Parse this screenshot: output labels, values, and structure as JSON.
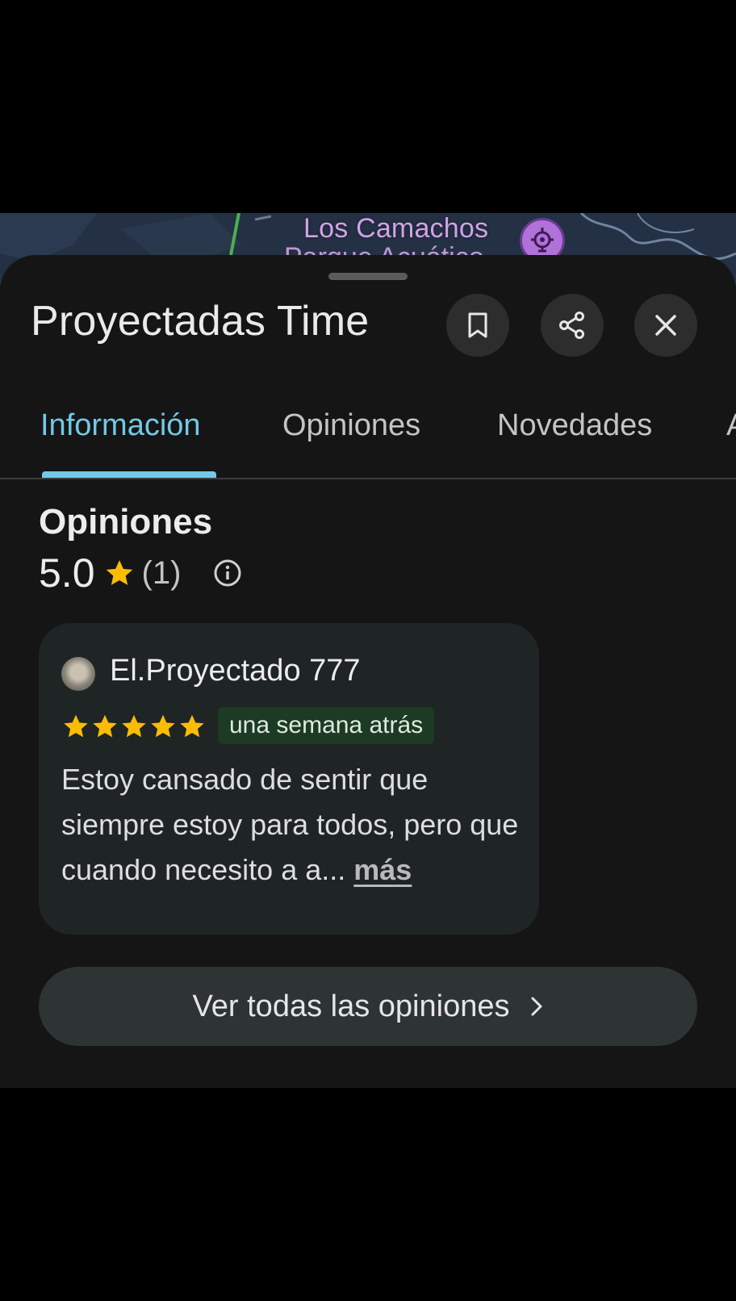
{
  "map": {
    "poi_label": "Los Camachos",
    "poi_label_partial": "Parque Acuático",
    "poi_icon": "amusement-park-icon"
  },
  "sheet": {
    "place_title": "Proyectadas Time",
    "actions": {
      "save_icon": "bookmark-icon",
      "share_icon": "share-icon",
      "close_icon": "close-icon"
    },
    "tabs": [
      {
        "label": "Información",
        "active": true
      },
      {
        "label": "Opiniones",
        "active": false
      },
      {
        "label": "Novedades",
        "active": false
      },
      {
        "label": "A",
        "active": false
      }
    ]
  },
  "reviews": {
    "section_title": "Opiniones",
    "rating_value": "5.0",
    "rating_count": "(1)",
    "review": {
      "author": "El.Proyectado 777",
      "stars": 5,
      "time_ago": "una semana atrás",
      "text": "Estoy cansado de sentir que siempre estoy para todos, pero que cuando necesito a a...",
      "more_label": "más"
    },
    "all_reviews_label": "Ver todas las opiniones"
  },
  "colors": {
    "accent": "#73c8e6",
    "star": "#fbbc04",
    "sheet_bg": "#151515",
    "card_bg": "#1f2424"
  }
}
